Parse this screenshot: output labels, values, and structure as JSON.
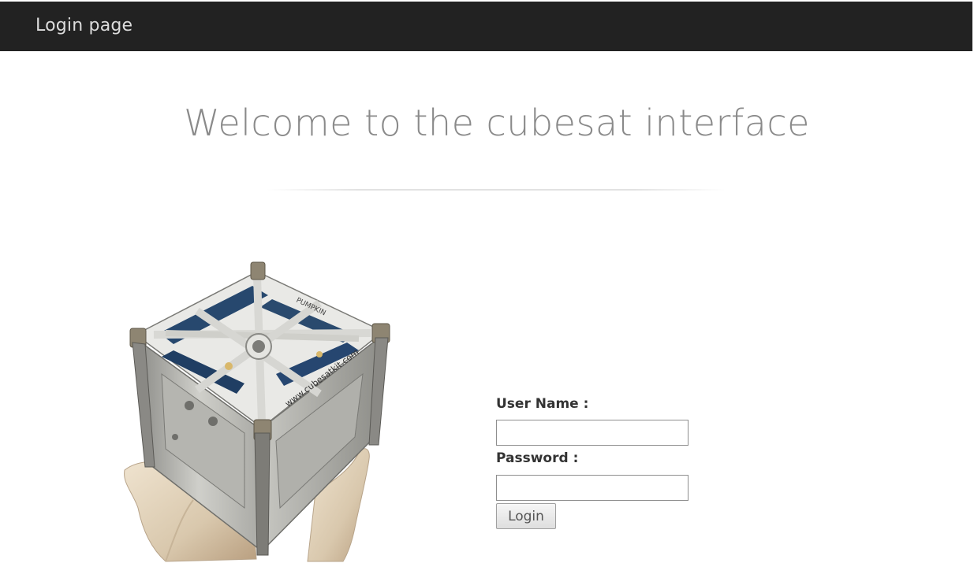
{
  "navbar": {
    "brand": "Login page"
  },
  "main": {
    "title": "Welcome to the cubesat interface",
    "image": {
      "alt": "cubesat",
      "panel_text": "www.cubesatkit.com",
      "top_text": "PUMPKIN"
    }
  },
  "login_form": {
    "username_label": "User Name :",
    "username_value": "",
    "password_label": "Password :",
    "password_value": "",
    "submit_label": "Login"
  },
  "colors": {
    "navbar_bg": "#222222",
    "navbar_text": "#dcdcdc",
    "title_text": "#8a8a8a",
    "label_text": "#333333"
  }
}
